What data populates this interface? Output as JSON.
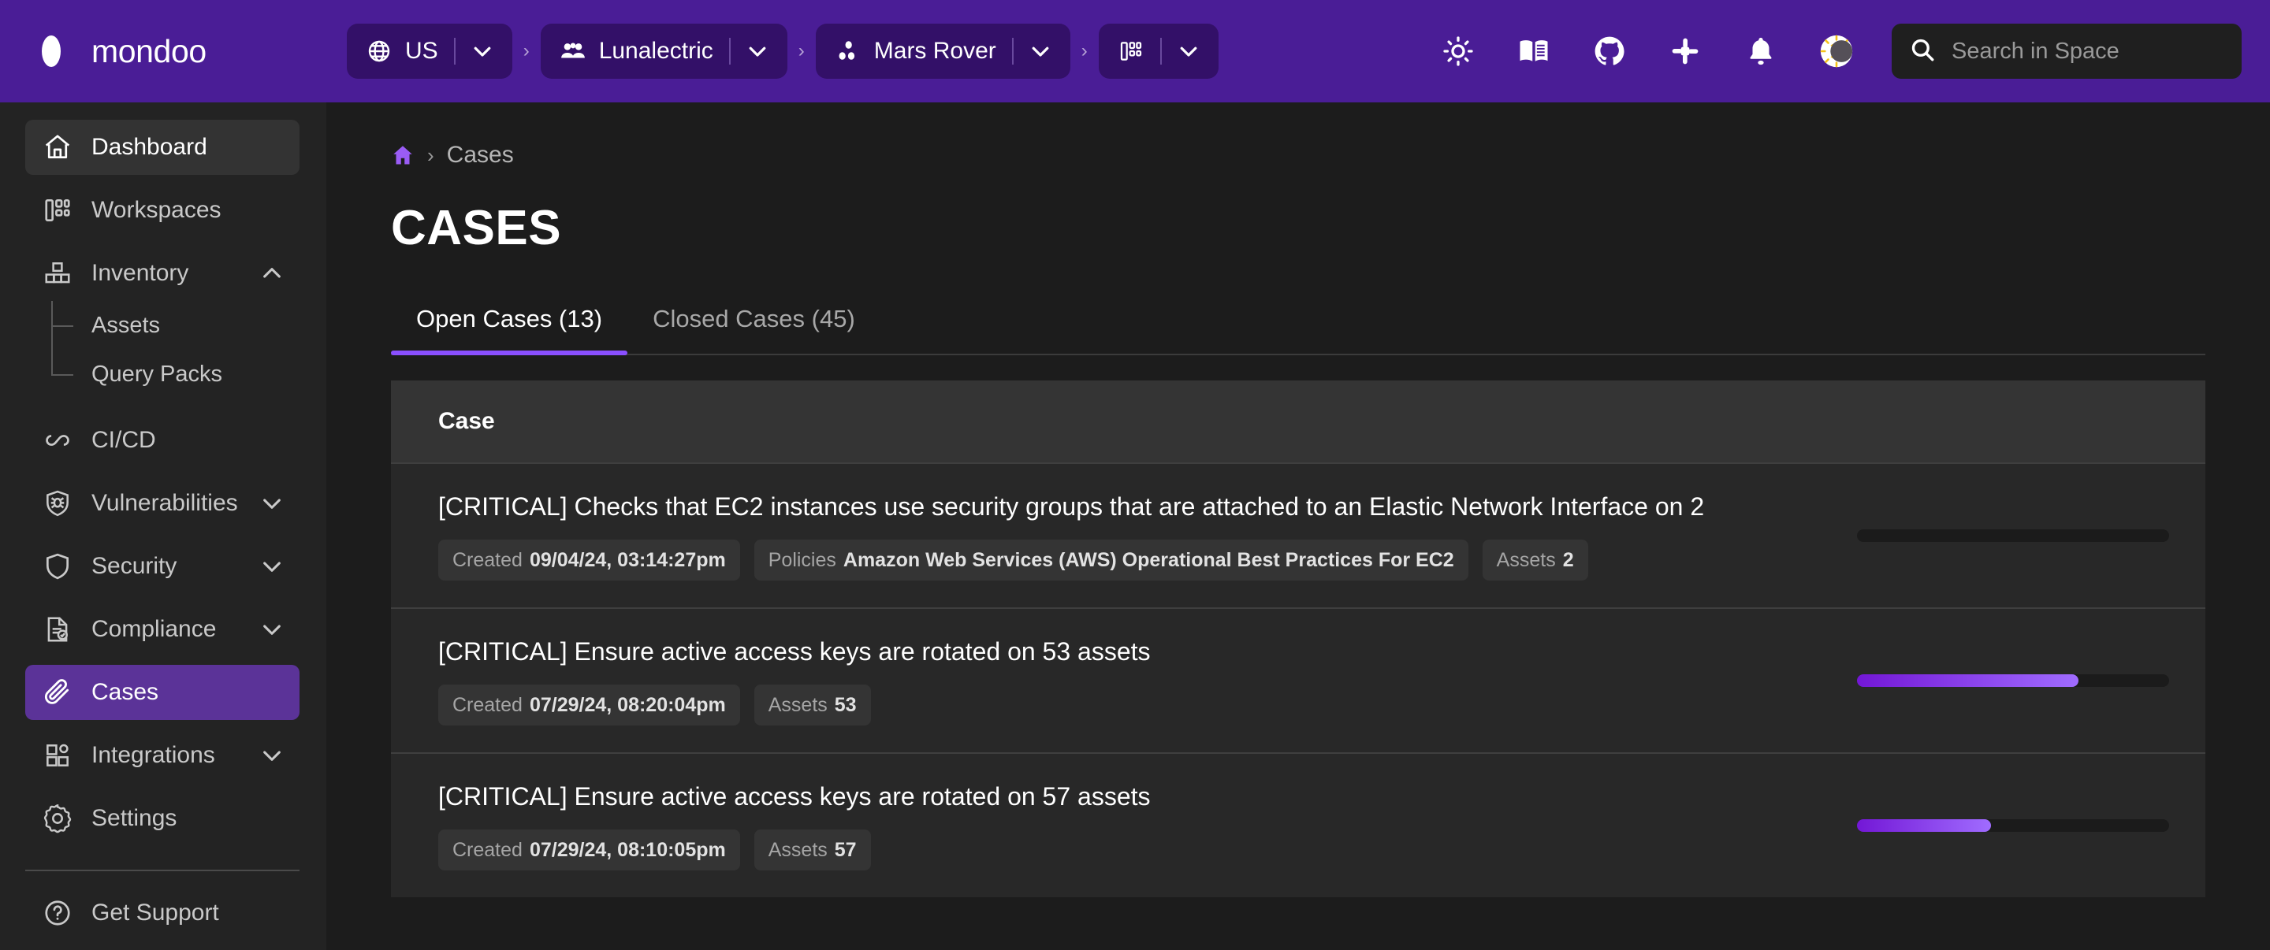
{
  "brand": {
    "name": "mondoo",
    "logo_icon": "mondoo-logo-icon",
    "header_bg": "#4a1d96",
    "accent": "#8a4fff",
    "active_nav_bg": "#5b3398"
  },
  "topbar": {
    "scope_pills": [
      {
        "icon": "globe-icon",
        "label": "US",
        "caret_icon": "chevron-down-icon"
      },
      {
        "icon": "organization-people-icon",
        "label": "Lunalectric",
        "caret_icon": "chevron-down-icon"
      },
      {
        "icon": "space-dots-icon",
        "label": "Mars Rover",
        "caret_icon": "chevron-down-icon"
      },
      {
        "icon": "workspaces-grid-icon",
        "label": "",
        "caret_icon": "chevron-down-icon"
      }
    ],
    "separator": "›",
    "action_icons": [
      "sun-brightness-icon",
      "documentation-book-icon",
      "github-icon",
      "slack-icon",
      "notifications-bell-icon",
      "theme-toggle-sun-moon-icon"
    ],
    "search": {
      "icon": "search-icon",
      "placeholder": "Search in Space",
      "value": ""
    }
  },
  "sidebar": {
    "items": [
      {
        "id": "dashboard",
        "label": "Dashboard",
        "icon": "home-icon",
        "state": "hover",
        "expandable": false
      },
      {
        "id": "workspaces",
        "label": "Workspaces",
        "icon": "workspaces-icon",
        "state": "normal",
        "expandable": false
      },
      {
        "id": "inventory",
        "label": "Inventory",
        "icon": "inventory-blocks-icon",
        "state": "normal",
        "expandable": true,
        "expanded": true,
        "caret_icon": "chevron-up-icon"
      },
      {
        "id": "cicd",
        "label": "CI/CD",
        "icon": "infinity-loop-icon",
        "state": "normal",
        "expandable": false
      },
      {
        "id": "vulnerabilities",
        "label": "Vulnerabilities",
        "icon": "bug-shield-icon",
        "state": "normal",
        "expandable": true,
        "expanded": false,
        "caret_icon": "chevron-down-icon"
      },
      {
        "id": "security",
        "label": "Security",
        "icon": "shield-icon",
        "state": "normal",
        "expandable": true,
        "expanded": false,
        "caret_icon": "chevron-down-icon"
      },
      {
        "id": "compliance",
        "label": "Compliance",
        "icon": "document-check-icon",
        "state": "normal",
        "expandable": true,
        "expanded": false,
        "caret_icon": "chevron-down-icon"
      },
      {
        "id": "cases",
        "label": "Cases",
        "icon": "paperclip-icon",
        "state": "selected",
        "expandable": false
      },
      {
        "id": "integrations",
        "label": "Integrations",
        "icon": "integrations-icon",
        "state": "normal",
        "expandable": true,
        "expanded": false,
        "caret_icon": "chevron-down-icon"
      },
      {
        "id": "settings",
        "label": "Settings",
        "icon": "gear-icon",
        "state": "normal",
        "expandable": false
      }
    ],
    "inventory_children": [
      {
        "id": "assets",
        "label": "Assets"
      },
      {
        "id": "query-packs",
        "label": "Query Packs"
      }
    ],
    "footer": {
      "label": "Get Support",
      "icon": "help-circle-icon"
    }
  },
  "breadcrumb": {
    "home_icon": "home-filled-icon",
    "separator": "›",
    "current": "Cases"
  },
  "page": {
    "title": "CASES"
  },
  "tabs": [
    {
      "id": "open-cases",
      "label": "Open Cases (13)",
      "active": true
    },
    {
      "id": "closed-cases",
      "label": "Closed Cases (45)",
      "active": false
    }
  ],
  "table": {
    "columns": [
      "Case"
    ],
    "rows": [
      {
        "title": "[CRITICAL] Checks that EC2 instances use security groups that are attached to an Elastic Network Interface on 2",
        "chips": [
          {
            "key": "Created",
            "value": "09/04/24, 03:14:27pm"
          },
          {
            "key": "Policies",
            "value": "Amazon Web Services (AWS) Operational Best Practices For EC2"
          },
          {
            "key": "Assets",
            "value": "2"
          }
        ],
        "progress_percent": 0
      },
      {
        "title": "[CRITICAL] Ensure active access keys are rotated on 53 assets",
        "chips": [
          {
            "key": "Created",
            "value": "07/29/24, 08:20:04pm"
          },
          {
            "key": "Assets",
            "value": "53"
          }
        ],
        "progress_percent": 71
      },
      {
        "title": "[CRITICAL] Ensure active access keys are rotated on 57 assets",
        "chips": [
          {
            "key": "Created",
            "value": "07/29/24, 08:10:05pm"
          },
          {
            "key": "Assets",
            "value": "57"
          }
        ],
        "progress_percent": 43
      }
    ]
  }
}
